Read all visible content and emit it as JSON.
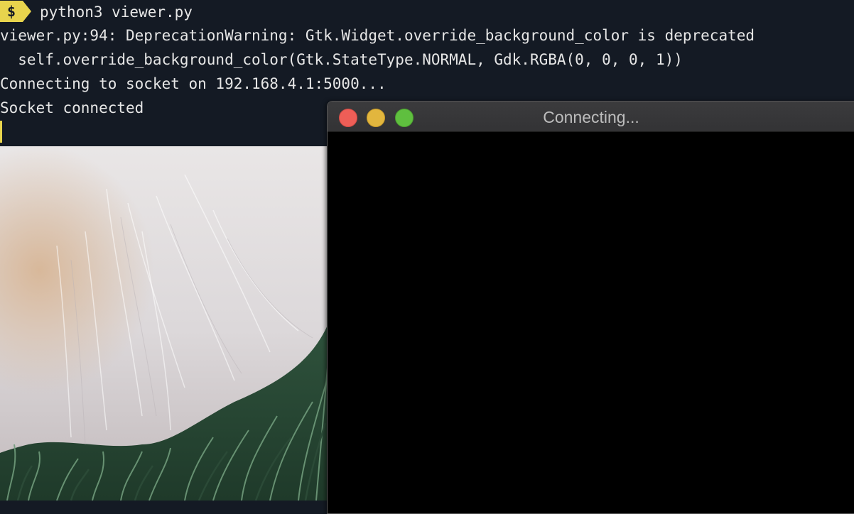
{
  "terminal": {
    "prompt_symbol": "$",
    "lines": [
      "python3 viewer.py",
      "viewer.py:94: DeprecationWarning: Gtk.Widget.override_background_color is deprecated",
      "  self.override_background_color(Gtk.StateType.NORMAL, Gdk.RGBA(0, 0, 0, 1))",
      "Connecting to socket on 192.168.4.1:5000...",
      "Socket connected"
    ]
  },
  "window": {
    "title": "Connecting..."
  },
  "colors": {
    "terminal_bg": "#141a24",
    "prompt_accent": "#e8d44d",
    "close": "#ee5e57",
    "minimize": "#e2b63e",
    "zoom": "#5fbf3f"
  },
  "photo": {
    "subject": "white fluffy fur on green grass"
  }
}
